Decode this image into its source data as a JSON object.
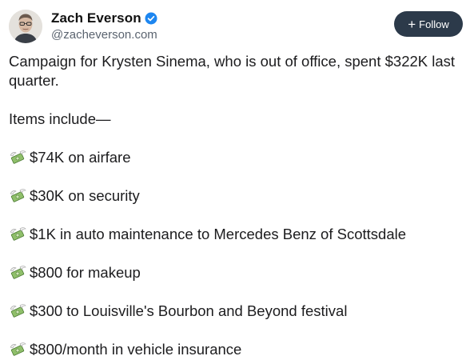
{
  "author": {
    "display_name": "Zach Everson",
    "handle": "@zacheverson.com",
    "verified_icon": "verified-check-icon",
    "avatar_icon": "avatar"
  },
  "follow_button": {
    "icon": "plus-icon",
    "label": "Follow"
  },
  "post": {
    "intro": "Campaign for Krysten Sinema, who is out of office, spent $322K last quarter.",
    "items_heading": "Items include—",
    "item_icon": "money-with-wings-icon",
    "items": [
      "$74K on airfare",
      "$30K on security",
      "$1K in auto maintenance to Mercedes Benz of Scottsdale",
      "$800 for makeup",
      "$300 to Louisville's Bourbon and Beyond festival",
      "$800/month in vehicle insurance"
    ]
  },
  "colors": {
    "follow_bg": "#2c3a4a",
    "verified_blue": "#1d86f0",
    "handle_gray": "#5b6470"
  }
}
